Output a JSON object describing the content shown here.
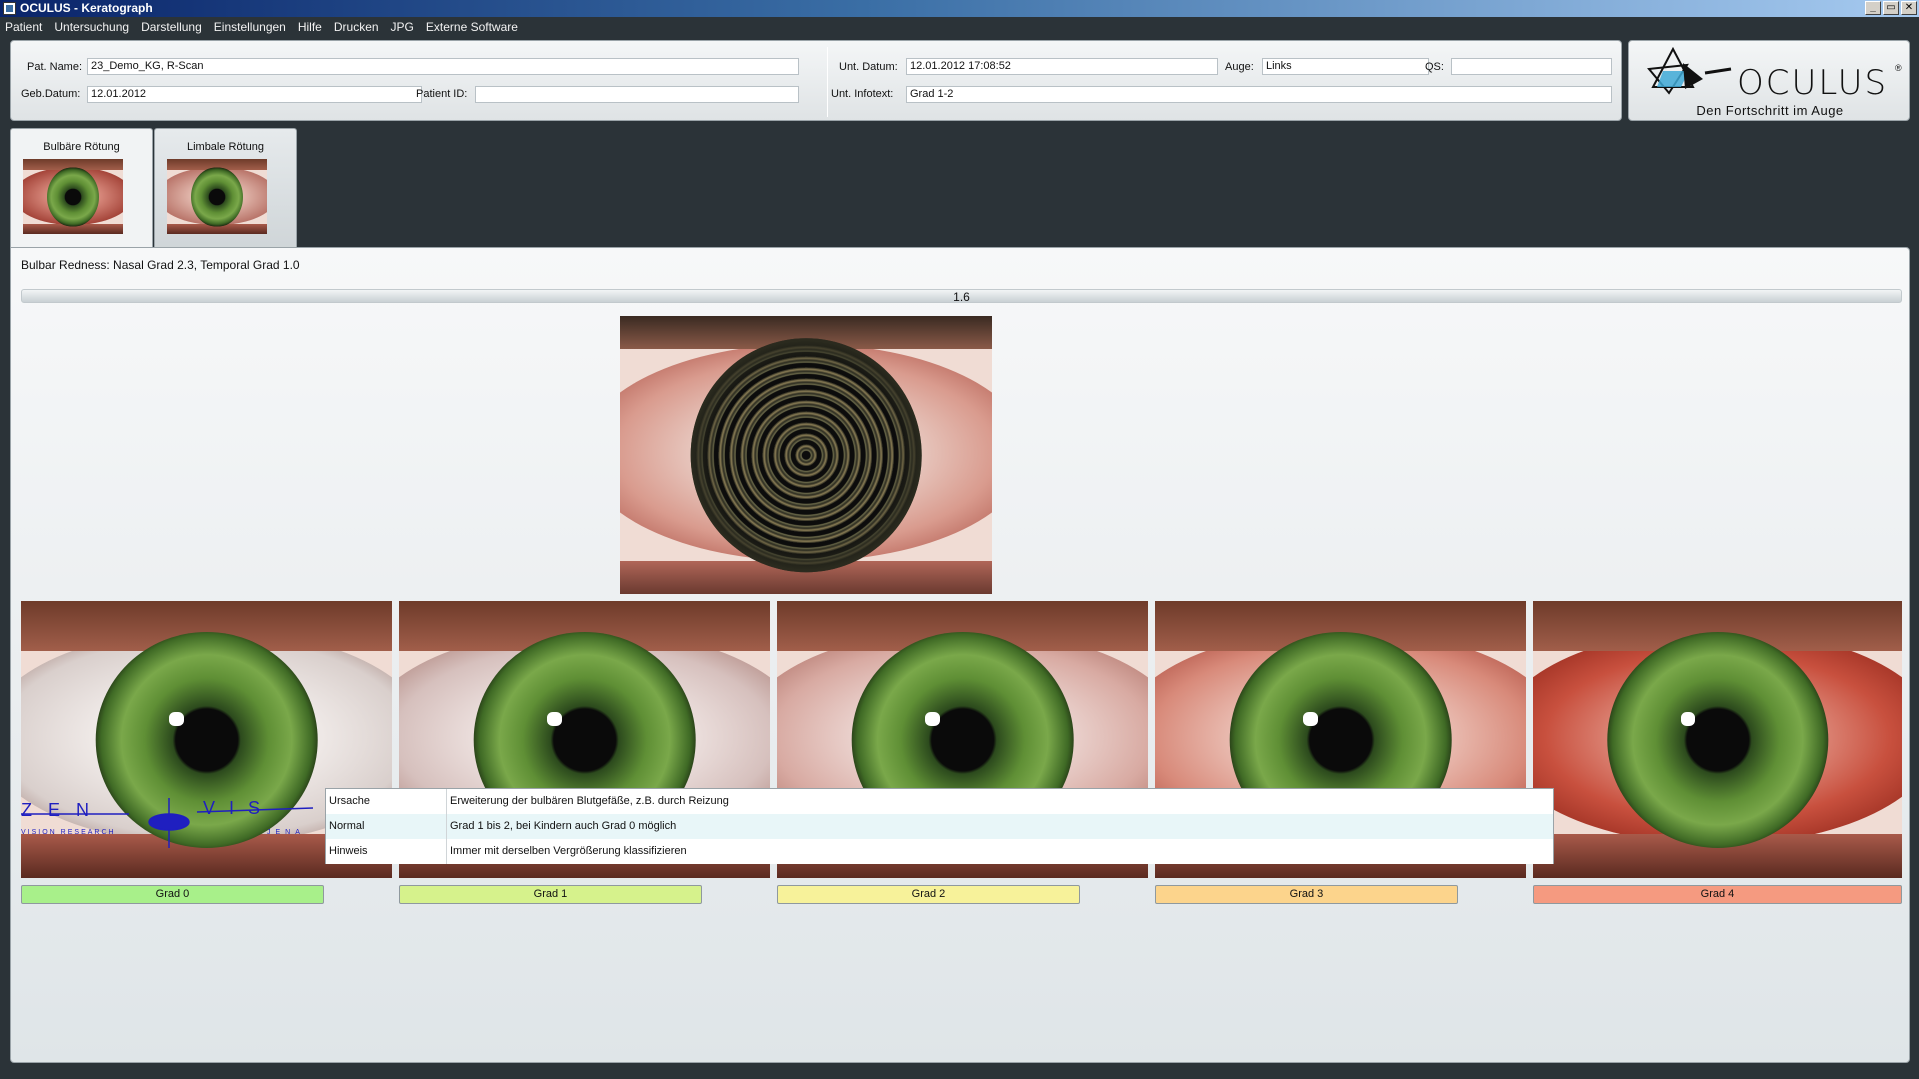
{
  "window": {
    "title": "OCULUS - Keratograph",
    "buttons": [
      "_",
      "▭",
      "✕"
    ]
  },
  "menu": [
    "Patient",
    "Untersuchung",
    "Darstellung",
    "Einstellungen",
    "Hilfe",
    "Drucken",
    "JPG",
    "Externe Software"
  ],
  "patient": {
    "name_label": "Pat. Name:",
    "name_value": "23_Demo_KG, R-Scan",
    "dob_label": "Geb.Datum:",
    "dob_value": "12.01.2012",
    "id_label": "Patient ID:",
    "id_value": ""
  },
  "exam": {
    "date_label": "Unt. Datum:",
    "date_value": "12.01.2012 17:08:52",
    "eye_label": "Auge:",
    "eye_value": "Links",
    "qs_label": "QS:",
    "qs_value": "",
    "info_label": "Unt. Infotext:",
    "info_value": "Grad 1-2"
  },
  "logo": {
    "brand": "OCULUS",
    "tagline": "Den Fortschritt im Auge"
  },
  "tabs": [
    {
      "label": "Bulbäre Rötung",
      "active": true
    },
    {
      "label": "Limbale Rötung",
      "active": false
    }
  ],
  "result": {
    "text": "Bulbar Redness: Nasal Grad 2.3, Temporal Grad 1.0",
    "scale_value": "1.6"
  },
  "grades": [
    {
      "label": "Grad 0",
      "color": "#a8f08a"
    },
    {
      "label": "Grad 1",
      "color": "#d6f28c"
    },
    {
      "label": "Grad 2",
      "color": "#f7f29a"
    },
    {
      "label": "Grad 3",
      "color": "#fcd48c"
    },
    {
      "label": "Grad 4",
      "color": "#f59a80"
    }
  ],
  "info": [
    {
      "key": "Ursache",
      "value": "Erweiterung der bulbären Blutgefäße, z.B. durch Reizung"
    },
    {
      "key": "Normal",
      "value": "Grad 1 bis 2, bei Kindern auch Grad 0 möglich"
    },
    {
      "key": "Hinweis",
      "value": "Immer mit derselben Vergrößerung klassifizieren"
    }
  ],
  "zen_logo": {
    "left_word": "ZEN",
    "right_word": "VIS",
    "sub_left": "VISION RESEARCH",
    "sub_right": "JENA"
  }
}
